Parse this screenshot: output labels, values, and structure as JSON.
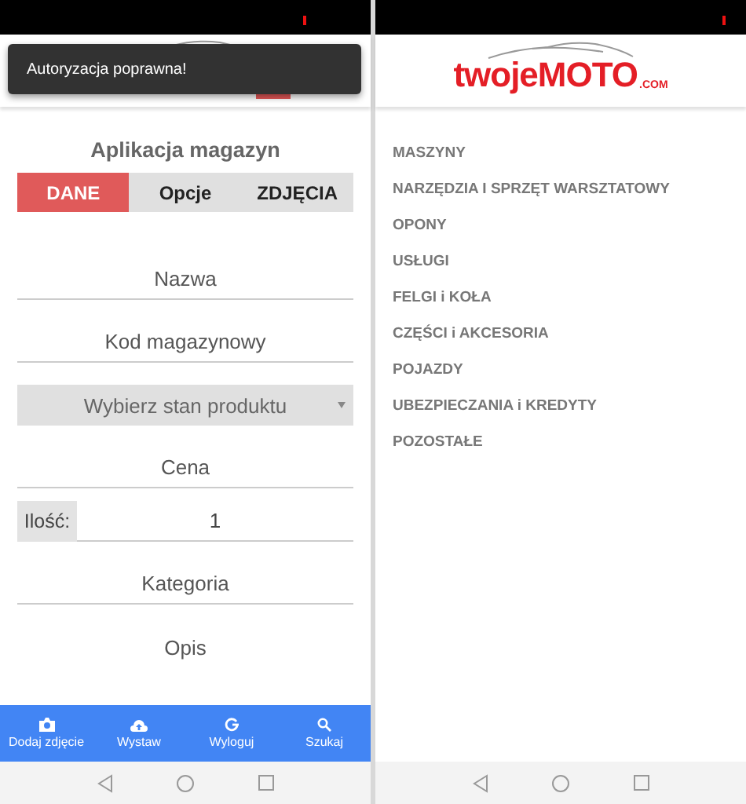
{
  "left_screen": {
    "toast": "Autoryzacja poprawna!",
    "title": "Aplikacja magazyn",
    "tabs": [
      {
        "label": "DANE",
        "selected": true
      },
      {
        "label": "Opcje",
        "selected": false
      },
      {
        "label": "ZDJĘCIA",
        "selected": false
      }
    ],
    "form": [
      {
        "kind": "text",
        "placeholder": "Nazwa"
      },
      {
        "kind": "text",
        "placeholder": "Kod magazynowy"
      },
      {
        "kind": "select",
        "placeholder": "Wybierz stan produktu"
      },
      {
        "kind": "text",
        "placeholder": "Cena"
      },
      {
        "kind": "labeled",
        "label": "Ilość:",
        "value": "1"
      },
      {
        "kind": "text",
        "placeholder": "Kategoria"
      },
      {
        "kind": "plain",
        "placeholder": "Opis"
      }
    ],
    "bottom_nav": [
      {
        "label": "Dodaj zdjęcie"
      },
      {
        "label": "Wystaw"
      },
      {
        "label": "Wyloguj"
      },
      {
        "label": "Szukaj"
      }
    ]
  },
  "right_screen": {
    "logo": {
      "name": "twojeMOTO",
      "suffix": ".COM"
    },
    "menu": [
      "MASZYNY",
      "NARZĘDZIA I SPRZĘT WARSZTATOWY",
      "OPONY",
      "USŁUGI",
      "FELGI i KOŁA",
      "CZĘŚCI i AKCESORIA",
      "POJAZDY",
      "UBEZPIECZANIA i KREDYTY",
      "POZOSTAŁE"
    ]
  }
}
